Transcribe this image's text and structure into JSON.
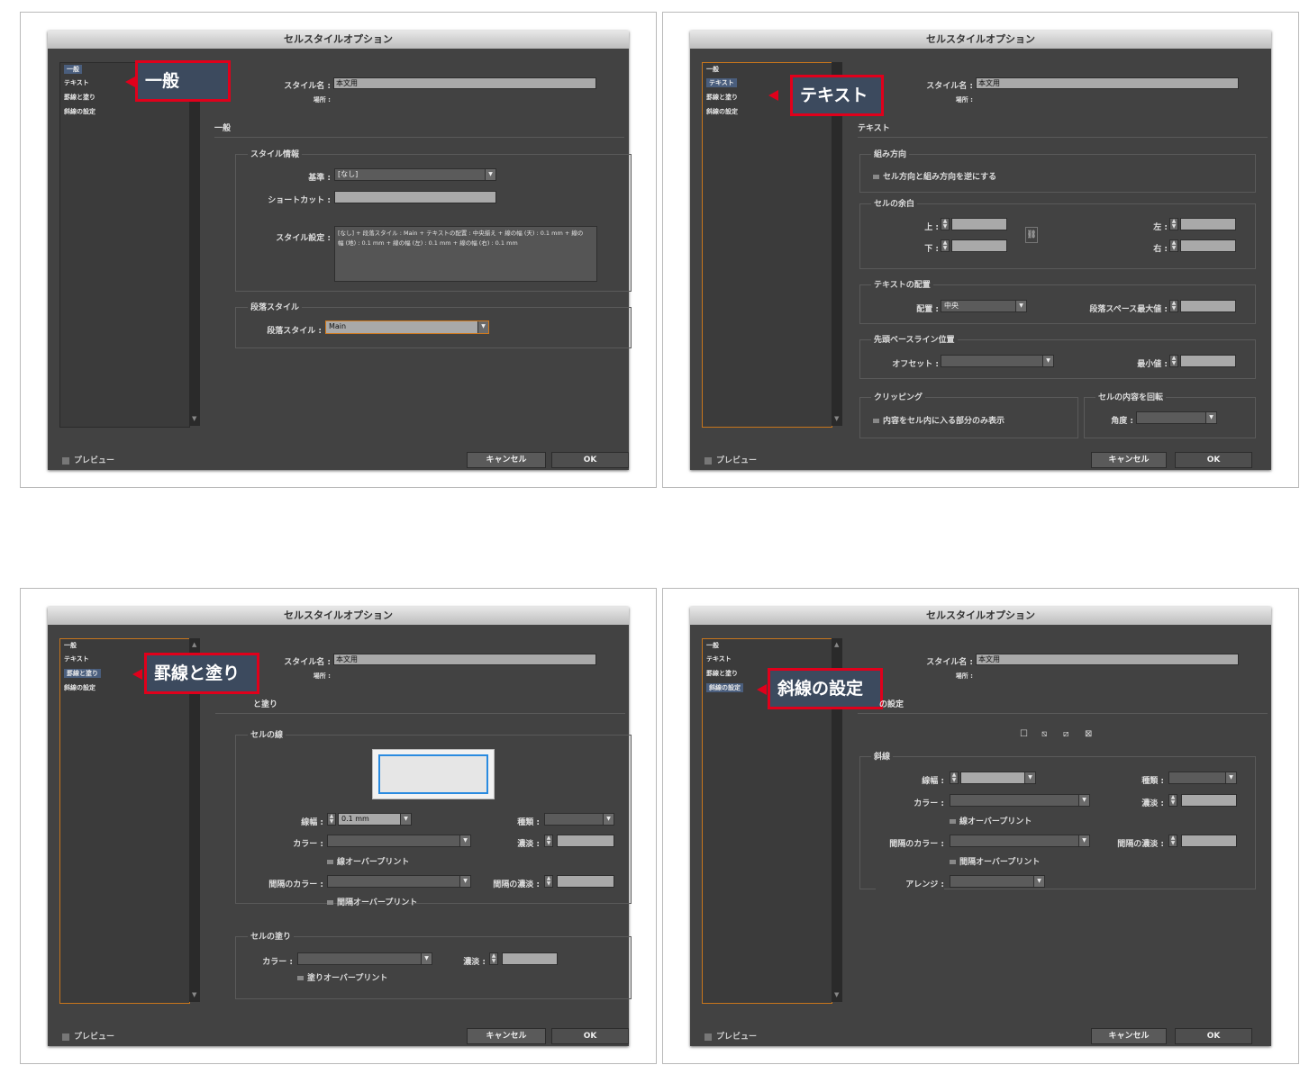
{
  "dialog_title": "セルスタイルオプション",
  "nav": [
    "一般",
    "テキスト",
    "罫線と塗り",
    "斜線の設定"
  ],
  "style_name_label": "スタイル名 :",
  "style_name_value": "本文用",
  "location_label": "場所 :",
  "preview_label": "プレビュー",
  "cancel_label": "キャンセル",
  "ok_label": "OK",
  "general": {
    "callout": "一般",
    "section": "一般",
    "style_info_title": "スタイル情報",
    "based_on_label": "基準 :",
    "based_on_value": "[なし]",
    "shortcut_label": "ショートカット :",
    "settings_label": "スタイル設定 :",
    "settings_text": "[なし] + 段落スタイル : Main + テキストの配置 : 中央揃え + 線の幅 (天) : 0.1 mm + 線の幅 (地) : 0.1 mm + 線の幅 (左) : 0.1 mm + 線の幅 (右) : 0.1 mm",
    "para_group_title": "段落スタイル",
    "para_label": "段落スタイル :",
    "para_value": "Main"
  },
  "text": {
    "callout": "テキスト",
    "section": "テキスト",
    "writing_title": "組み方向",
    "reverse_check": "セル方向と組み方向を逆にする",
    "inset_title": "セルの余白",
    "top_label": "上 :",
    "bottom_label": "下 :",
    "left_label": "左 :",
    "right_label": "右 :",
    "align_title": "テキストの配置",
    "align_label": "配置 :",
    "align_value": "中央",
    "para_spacing_label": "段落スペース最大値 :",
    "baseline_title": "先頭ベースライン位置",
    "offset_label": "オフセット :",
    "min_label": "最小値 :",
    "clip_title": "クリッピング",
    "clip_check": "内容をセル内に入る部分のみ表示",
    "rotate_title": "セルの内容を回転",
    "angle_label": "角度 :"
  },
  "stroke": {
    "callout": "罫線と塗り",
    "section_tail": "と塗り",
    "cell_stroke_title": "セルの線",
    "weight_label": "線幅 :",
    "weight_value": "0.1 mm",
    "type_label": "種類 :",
    "color_label": "カラー :",
    "tint_label": "濃淡 :",
    "overprint_stroke": "線オーバープリント",
    "gap_color_label": "間隔のカラー :",
    "gap_tint_label": "間隔の濃淡 :",
    "overprint_gap": "間隔オーバープリント",
    "fill_title": "セルの塗り",
    "fill_color_label": "カラー :",
    "fill_tint_label": "濃淡 :",
    "overprint_fill": "塗りオーバープリント"
  },
  "diagonal": {
    "callout": "斜線の設定",
    "section_tail": "の設定",
    "icons": [
      "no-diagonal-icon",
      "diagonal-down-icon",
      "diagonal-up-icon",
      "diagonal-cross-icon"
    ],
    "line_title": "斜線",
    "weight_label": "線幅 :",
    "type_label": "種類 :",
    "color_label": "カラー :",
    "tint_label": "濃淡 :",
    "overprint_stroke": "線オーバープリント",
    "gap_color_label": "間隔のカラー :",
    "gap_tint_label": "間隔の濃淡 :",
    "overprint_gap": "間隔オーバープリント",
    "arrange_label": "アレンジ :"
  },
  "colors": {
    "dialog_bg": "#424242",
    "callout_border": "#e0001b",
    "focus_orange": "#c8761c",
    "selected_nav": "#4a5e7d"
  }
}
